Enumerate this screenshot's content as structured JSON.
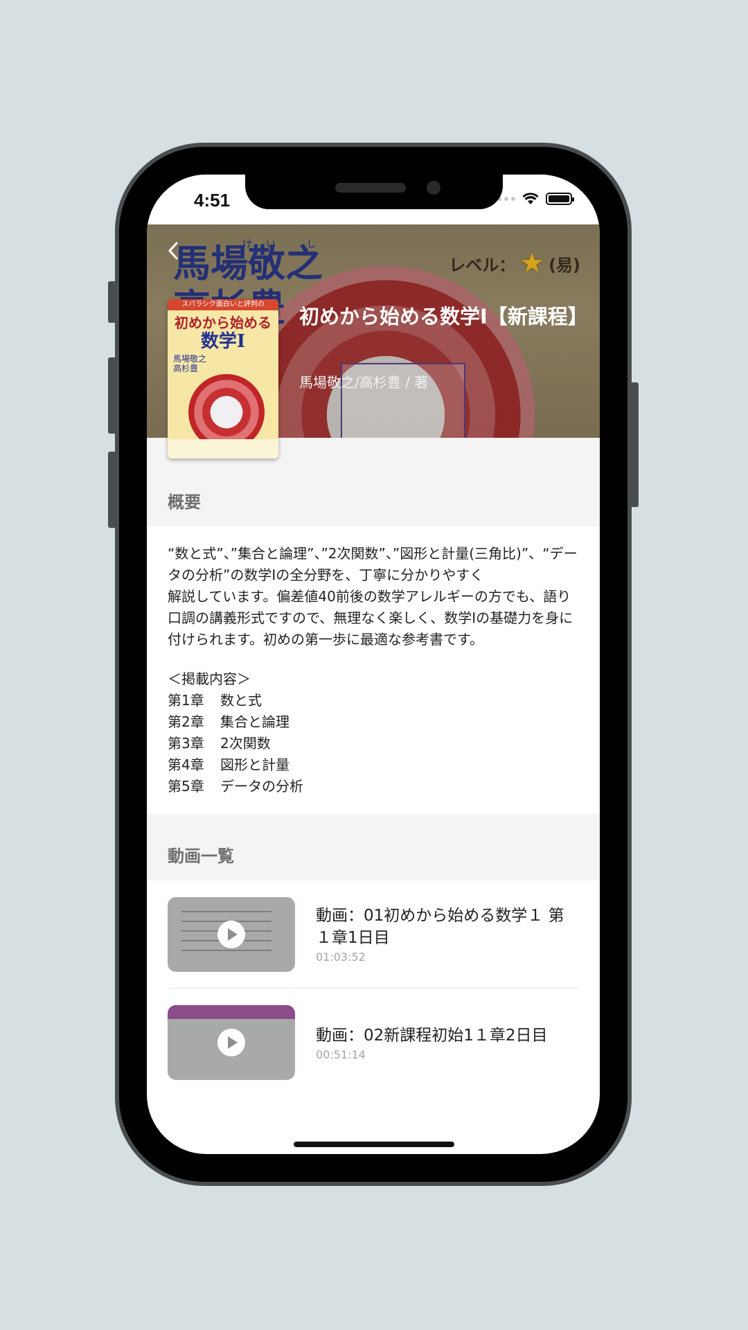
{
  "statusbar": {
    "time": "4:51"
  },
  "hero": {
    "back_icon": "chevron-left-icon",
    "bg_title": "馬場敬之\n高杉豊",
    "bg_ruby": "けい し",
    "bg_level_label": "レベル：",
    "bg_level_value": "(易)",
    "title": "初めから始める数学Ⅰ【新課程】",
    "author": "馬場敬之/高杉豊 / 著"
  },
  "cover": {
    "top_band": "スバラシク面白いと評判の",
    "title": "初めから始める",
    "subtitle": "数学Ⅰ",
    "authors": "馬場敬之\n高杉豊"
  },
  "overview": {
    "heading": "概要",
    "description": "“数と式”、”集合と論理”、”2次関数”、”図形と計量(三角比)”、“データの分析”の数学Ⅰの全分野を、丁寧に分かりやすく\n解説しています。偏差値40前後の数学アレルギーの方でも、語り口調の講義形式ですので、無理なく楽しく、数学Ⅰの基礎力を身に付けられます。初めの第一歩に最適な参考書です。",
    "toc_heading": "＜掲載内容＞",
    "toc": [
      {
        "chapter": "第1章",
        "title": "数と式"
      },
      {
        "chapter": "第2章",
        "title": "集合と論理"
      },
      {
        "chapter": "第3章",
        "title": "2次関数"
      },
      {
        "chapter": "第4章",
        "title": "図形と計量"
      },
      {
        "chapter": "第5章",
        "title": "データの分析"
      }
    ]
  },
  "videos": {
    "heading": "動画一覧",
    "items": [
      {
        "title": "動画：01初めから始める数学１ 第１章1日目",
        "duration": "01:03:52"
      },
      {
        "title": "動画：02新課程初始1１章2日目",
        "duration": "00:51:14"
      }
    ]
  }
}
